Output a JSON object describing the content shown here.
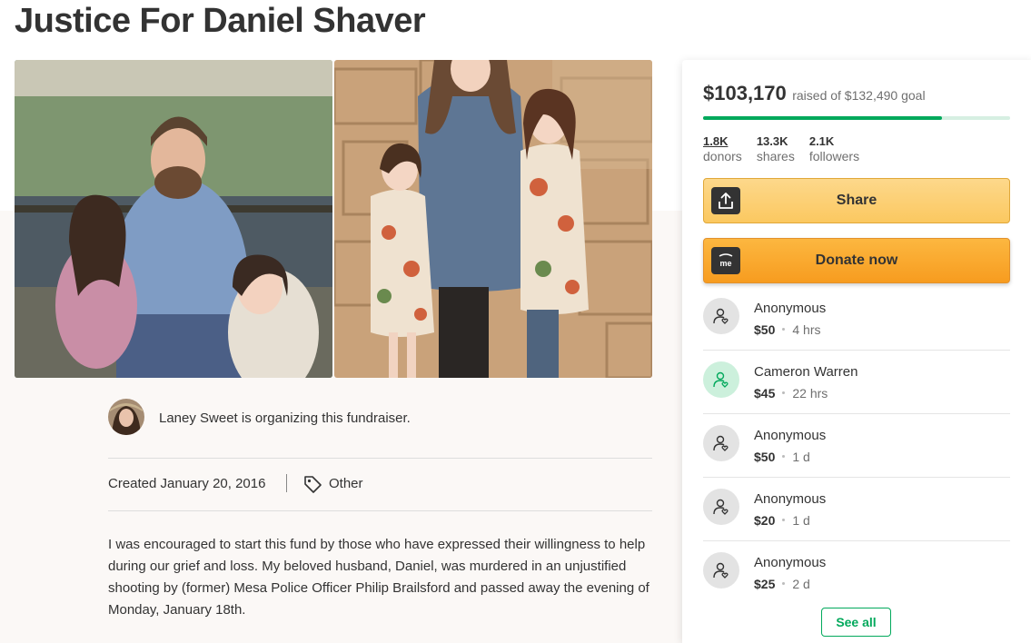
{
  "page": {
    "title": "Justice For Daniel Shaver"
  },
  "organizer": {
    "text": "Laney Sweet is organizing this fundraiser."
  },
  "meta": {
    "created": "Created January 20, 2016",
    "category": "Other"
  },
  "story": {
    "text": "I was encouraged to start this fund by those who have expressed their willingness to help during our grief and loss. My beloved husband, Daniel, was murdered in an unjustified shooting by (former) Mesa Police Officer Philip Brailsford and passed away the evening of Monday, January 18th."
  },
  "progress": {
    "raised": "$103,170",
    "goal_text": "raised of $132,490 goal",
    "fraction": 0.779
  },
  "stats": [
    {
      "value": "1.8K",
      "label": "donors"
    },
    {
      "value": "13.3K",
      "label": "shares"
    },
    {
      "value": "2.1K",
      "label": "followers"
    }
  ],
  "buttons": {
    "share": "Share",
    "donate": "Donate now",
    "donate_icon_text": "me"
  },
  "donations": [
    {
      "name": "Anonymous",
      "amount": "$50",
      "time": "4 hrs"
    },
    {
      "name": "Cameron Warren",
      "amount": "$45",
      "time": "22 hrs"
    },
    {
      "name": "Anonymous",
      "amount": "$50",
      "time": "1 d"
    },
    {
      "name": "Anonymous",
      "amount": "$20",
      "time": "1 d"
    },
    {
      "name": "Anonymous",
      "amount": "$25",
      "time": "2 d"
    }
  ],
  "see_all": "See all",
  "colors": {
    "brand_green": "#02a95c",
    "progress_track": "#d6efe2",
    "share_button": "#fbc860",
    "donate_button": "#f79c1f"
  },
  "icons": {
    "share": "share-upload-icon",
    "donate": "gofundme-logo-icon",
    "donor": "donor-heart-icon",
    "category": "tag-icon"
  }
}
